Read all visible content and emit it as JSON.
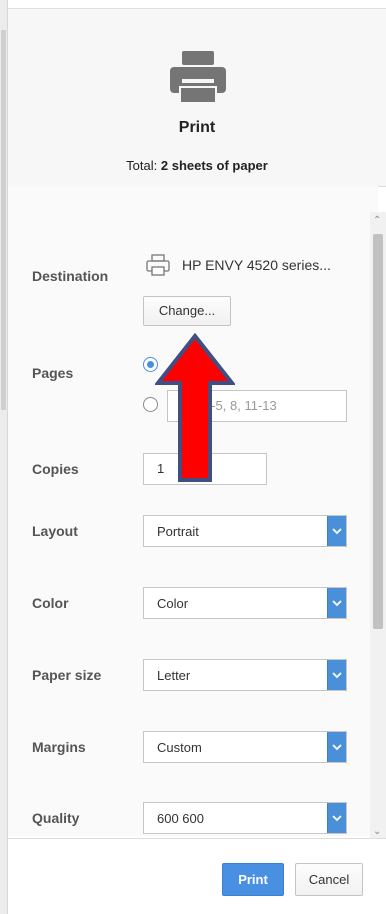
{
  "header": {
    "title": "Print",
    "total_prefix": "Total:",
    "total_value": "2 sheets of paper",
    "icon": "printer-icon"
  },
  "destination": {
    "label": "Destination",
    "printer_name": "HP ENVY 4520 series...",
    "icon": "printer-icon",
    "change_label": "Change..."
  },
  "pages": {
    "label": "Pages",
    "option_all_selected": true,
    "custom_placeholder": "e.g. 1-5, 8, 11-13",
    "custom_visible_text": "1-5, 8, 11-13"
  },
  "copies": {
    "label": "Copies",
    "value": "1"
  },
  "layout": {
    "label": "Layout",
    "selected": "Portrait"
  },
  "color": {
    "label": "Color",
    "selected": "Color"
  },
  "paper_size": {
    "label": "Paper size",
    "selected": "Letter"
  },
  "margins": {
    "label": "Margins",
    "selected": "Custom"
  },
  "quality": {
    "label": "Quality",
    "selected": "600 600"
  },
  "footer": {
    "print_label": "Print",
    "cancel_label": "Cancel"
  },
  "colors": {
    "accent": "#4a90e2",
    "annotation_arrow_fill": "#ff0000",
    "annotation_arrow_outline": "#3f4f82"
  }
}
